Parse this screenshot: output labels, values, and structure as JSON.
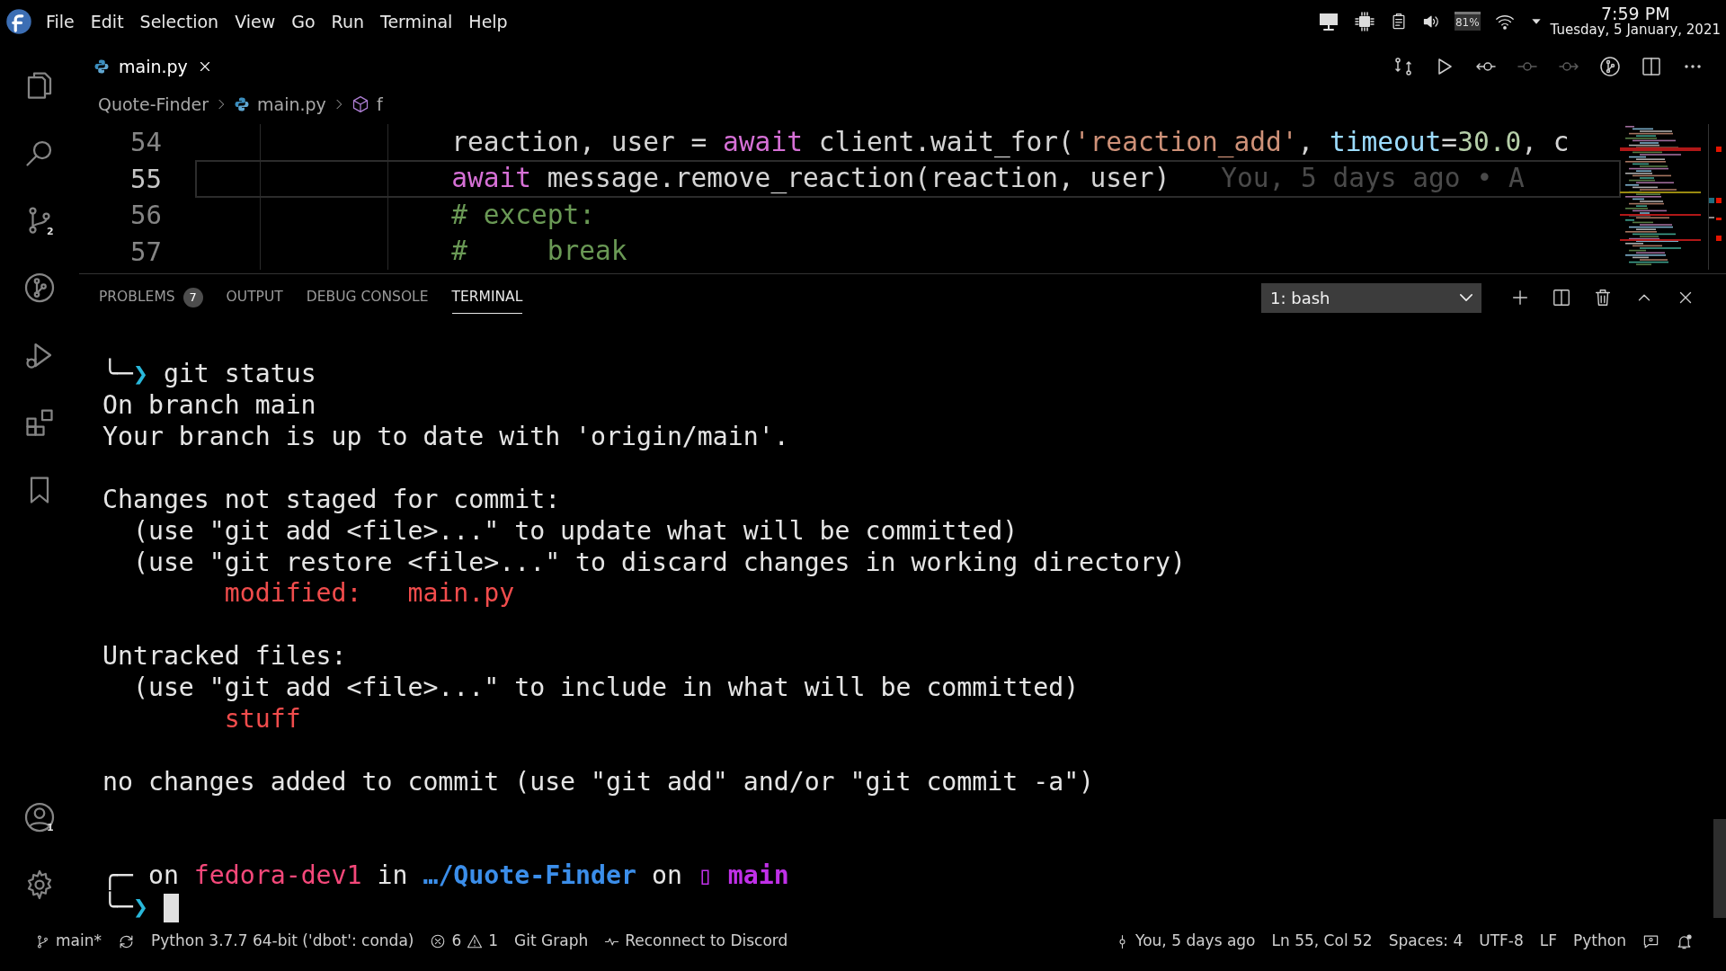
{
  "menu_bar": {
    "items": [
      "File",
      "Edit",
      "Selection",
      "View",
      "Go",
      "Run",
      "Terminal",
      "Help"
    ]
  },
  "system_tray": {
    "battery": "81%",
    "time": "7:59 PM",
    "date": "Tuesday, 5 January, 2021"
  },
  "activity_bar": {
    "items": [
      {
        "kind": "files"
      },
      {
        "kind": "search"
      },
      {
        "kind": "source-control",
        "badge": "2"
      },
      {
        "kind": "git-graph"
      },
      {
        "kind": "run"
      },
      {
        "kind": "extensions"
      },
      {
        "kind": "bookmark"
      }
    ],
    "bottom": [
      {
        "kind": "account",
        "badge": "1"
      },
      {
        "kind": "settings"
      }
    ]
  },
  "editor": {
    "tabs": [
      {
        "label": "main.py",
        "selected": true
      }
    ],
    "actions": [
      {
        "kind": "compare",
        "disabled": false
      },
      {
        "kind": "run",
        "disabled": false
      },
      {
        "kind": "previous",
        "disabled": false
      },
      {
        "kind": "commit",
        "disabled": true
      },
      {
        "kind": "next",
        "disabled": true
      },
      {
        "kind": "git-graph",
        "disabled": false
      },
      {
        "kind": "split",
        "disabled": false
      },
      {
        "kind": "more",
        "disabled": false
      }
    ],
    "breadcrumb": [
      {
        "kind": "folder",
        "label": "Quote-Finder"
      },
      {
        "kind": "python",
        "label": "main.py"
      },
      {
        "kind": "symbol",
        "label": "f"
      }
    ],
    "lines": [
      {
        "number": "54",
        "current": false,
        "segments": [
          {
            "text": "reaction, user = ",
            "color": "#d4d4d4"
          },
          {
            "text": "await",
            "color": "#d670d6"
          },
          {
            "text": " client.wait_for(",
            "color": "#d4d4d4"
          },
          {
            "text": "'reaction_add'",
            "color": "#ce9178"
          },
          {
            "text": ", ",
            "color": "#d4d4d4"
          },
          {
            "text": "timeout",
            "color": "#9cdcfe"
          },
          {
            "text": "=",
            "color": "#d4d4d4"
          },
          {
            "text": "30.0",
            "color": "#b5cea8"
          },
          {
            "text": ", c",
            "color": "#d4d4d4"
          }
        ]
      },
      {
        "number": "55",
        "current": true,
        "segments": [
          {
            "text": "await",
            "color": "#d670d6"
          },
          {
            "text": " message.remove_reaction(reaction, user)",
            "color": "#d4d4d4"
          }
        ],
        "annotation": "You, 5 days ago • A"
      },
      {
        "number": "56",
        "current": false,
        "segments": [
          {
            "text": "# except:",
            "color": "#6a9955"
          }
        ]
      },
      {
        "number": "57",
        "current": false,
        "segments": [
          {
            "text": "#     break",
            "color": "#6a9955"
          }
        ]
      }
    ]
  },
  "panel": {
    "tabs": [
      {
        "label": "PROBLEMS",
        "badge": "7",
        "selected": false
      },
      {
        "label": "OUTPUT",
        "selected": false
      },
      {
        "label": "DEBUG CONSOLE",
        "selected": false
      },
      {
        "label": "TERMINAL",
        "selected": true
      }
    ],
    "terminal_select": "1: bash",
    "terminal": {
      "lines": [
        {
          "kind": "text",
          "segments": [
            {
              "text": "╰─",
              "color": "#e5e5e5"
            },
            {
              "text": "❯",
              "color": "#29b8db"
            },
            {
              "text": " git status",
              "color": "#e5e5e5"
            }
          ]
        },
        {
          "kind": "text",
          "segments": [
            {
              "text": "On branch main",
              "color": "#e5e5e5"
            }
          ]
        },
        {
          "kind": "text",
          "segments": [
            {
              "text": "Your branch is up to date with 'origin/main'.",
              "color": "#e5e5e5"
            }
          ]
        },
        {
          "kind": "blank"
        },
        {
          "kind": "text",
          "segments": [
            {
              "text": "Changes not staged for commit:",
              "color": "#e5e5e5"
            }
          ]
        },
        {
          "kind": "text",
          "segments": [
            {
              "text": "  (use \"git add <file>...\" to update what will be committed)",
              "color": "#e5e5e5"
            }
          ]
        },
        {
          "kind": "text",
          "segments": [
            {
              "text": "  (use \"git restore <file>...\" to discard changes in working directory)",
              "color": "#e5e5e5"
            }
          ]
        },
        {
          "kind": "text",
          "segments": [
            {
              "text": "        modified:   main.py",
              "color": "#f14c4c"
            }
          ]
        },
        {
          "kind": "blank"
        },
        {
          "kind": "text",
          "segments": [
            {
              "text": "Untracked files:",
              "color": "#e5e5e5"
            }
          ]
        },
        {
          "kind": "text",
          "segments": [
            {
              "text": "  (use \"git add <file>...\" to include in what will be committed)",
              "color": "#e5e5e5"
            }
          ]
        },
        {
          "kind": "text",
          "segments": [
            {
              "text": "        stuff",
              "color": "#f14c4c"
            }
          ]
        },
        {
          "kind": "blank"
        },
        {
          "kind": "text",
          "segments": [
            {
              "text": "no changes added to commit (use \"git add\" and/or \"git commit -a\")",
              "color": "#e5e5e5"
            }
          ]
        },
        {
          "kind": "blank"
        },
        {
          "kind": "blank"
        },
        {
          "kind": "text",
          "segments": [
            {
              "text": "╭─ ",
              "color": "#e5e5e5"
            },
            {
              "text": "on ",
              "color": "#e5e5e5"
            },
            {
              "text": "fedora-dev1",
              "color": "#f5487a"
            },
            {
              "text": " in ",
              "color": "#e5e5e5"
            },
            {
              "text": "…/Quote-Finder",
              "color": "#3b8eea",
              "bold": true
            },
            {
              "text": " on ",
              "color": "#e5e5e5"
            },
            {
              "text": "▯",
              "color": "#c030e8"
            },
            {
              "text": " main",
              "color": "#c030e8",
              "bold": true
            }
          ]
        },
        {
          "kind": "text",
          "cursor": true,
          "segments": [
            {
              "text": "╰─",
              "color": "#e5e5e5"
            },
            {
              "text": "❯",
              "color": "#29b8db"
            }
          ]
        }
      ]
    }
  },
  "status_bar": {
    "left": [
      {
        "kind": "branch",
        "text": "main*"
      },
      {
        "kind": "sync"
      },
      {
        "kind": "text",
        "text": "Python 3.7.7 64-bit ('dbot': conda)"
      },
      {
        "kind": "problems",
        "errors": "6",
        "warnings": "1"
      },
      {
        "kind": "text",
        "text": "Git Graph"
      },
      {
        "kind": "pulse",
        "text": "Reconnect to Discord"
      }
    ],
    "right": [
      {
        "kind": "commit",
        "text": "You, 5 days ago"
      },
      {
        "kind": "text",
        "text": "Ln 55, Col 52"
      },
      {
        "kind": "text",
        "text": "Spaces: 4"
      },
      {
        "kind": "text",
        "text": "UTF-8"
      },
      {
        "kind": "text",
        "text": "LF"
      },
      {
        "kind": "text",
        "text": "Python"
      },
      {
        "kind": "feedback"
      },
      {
        "kind": "bell"
      }
    ]
  }
}
